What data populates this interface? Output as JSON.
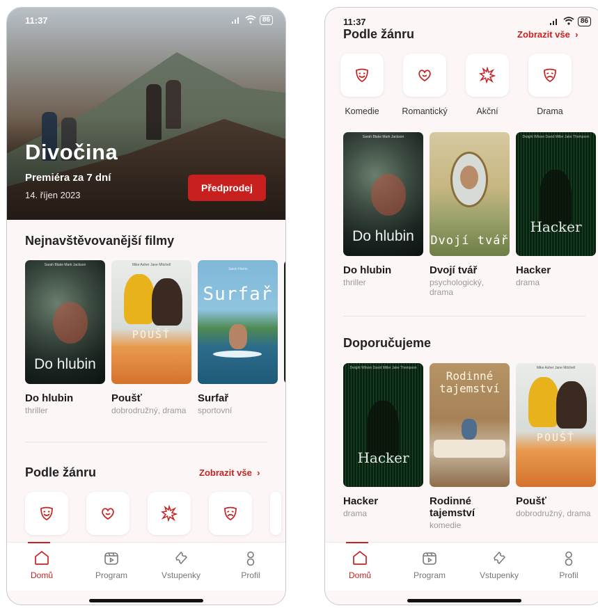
{
  "colors": {
    "accent": "#c8201f",
    "background": "#fdf6f6"
  },
  "status": {
    "time": "11:37",
    "battery": "86"
  },
  "left": {
    "hero": {
      "title": "Divočina",
      "subtitle": "Premiéra za 7 dní",
      "date": "14. říjen 2023",
      "button": "Předprodej"
    },
    "popular": {
      "title": "Nejnavštěvovanější filmy",
      "movies": [
        {
          "name": "Do hlubin",
          "genre": "thriller",
          "poster_text": "Do hlubin",
          "credit": "Sarah Blake  Mark Jackson"
        },
        {
          "name": "Poušť",
          "genre": "dobrodružný, drama",
          "poster_text": "POUŠŤ",
          "credit": "Mike Asher      Jane Mitchell"
        },
        {
          "name": "Surfař",
          "genre": "sportovní",
          "poster_text": "Surfař",
          "credit": "Jason Harris"
        }
      ]
    },
    "genres": {
      "title": "Podle žánru",
      "see_all": "Zobrazit vše",
      "items": [
        {
          "label": "Komedie",
          "icon": "comedy-mask-icon"
        },
        {
          "label": "Romantický",
          "icon": "heart-mask-icon"
        },
        {
          "label": "Akční",
          "icon": "explosion-icon"
        },
        {
          "label": "Drama",
          "icon": "drama-mask-icon"
        }
      ]
    }
  },
  "right": {
    "genres": {
      "title": "Podle žánru",
      "see_all": "Zobrazit vše",
      "items": [
        {
          "label": "Komedie",
          "icon": "comedy-mask-icon"
        },
        {
          "label": "Romantický",
          "icon": "heart-mask-icon"
        },
        {
          "label": "Akční",
          "icon": "explosion-icon"
        },
        {
          "label": "Drama",
          "icon": "drama-mask-icon"
        }
      ]
    },
    "genre_movies": [
      {
        "name": "Do hlubin",
        "genre": "thriller",
        "poster_text": "Do hlubin",
        "credit": "Sarah Blake  Mark Jackson"
      },
      {
        "name": "Dvojí tvář",
        "genre": "psychologický, drama",
        "poster_text": "Dvojí tvář",
        "credit": ""
      },
      {
        "name": "Hacker",
        "genre": "drama",
        "poster_text": "Hacker",
        "credit": "Dwight Wilson   David Miller   Jake Thompson"
      }
    ],
    "recommended": {
      "title": "Doporučujeme",
      "movies": [
        {
          "name": "Hacker",
          "genre": "drama",
          "poster_text": "Hacker",
          "credit": "Dwight Wilson   David Miller   Jake Thompson"
        },
        {
          "name": "Rodinné tajemství",
          "genre": "komedie",
          "poster_text": "Rodinné tajemství",
          "credit": ""
        },
        {
          "name": "Poušť",
          "genre": "dobrodružný, drama",
          "poster_text": "POUŠŤ",
          "credit": "Mike Asher      Jane Mitchell"
        }
      ]
    }
  },
  "tabs": [
    {
      "label": "Domů",
      "icon": "home-icon",
      "active": true
    },
    {
      "label": "Program",
      "icon": "program-icon",
      "active": false
    },
    {
      "label": "Vstupenky",
      "icon": "ticket-icon",
      "active": false
    },
    {
      "label": "Profil",
      "icon": "profile-icon",
      "active": false
    }
  ]
}
